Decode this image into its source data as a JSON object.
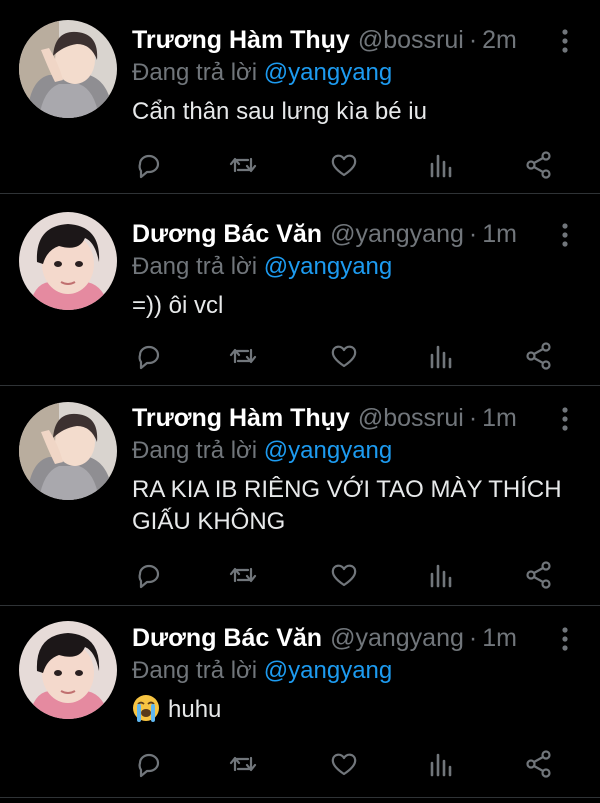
{
  "tweets": [
    {
      "avatar": "avatar-boy-sweater",
      "name": "Trương Hàm Thụy",
      "handle": "@bossrui",
      "dot": "·",
      "time": "2m",
      "replying_prefix": "Đang trả lời ",
      "replying_to": "@yangyang",
      "text": "Cẩn thân sau lưng kìa bé iu"
    },
    {
      "avatar": "avatar-boy-closeup",
      "name": "Dương Bác Văn",
      "handle": "@yangyang",
      "dot": "·",
      "time": "1m",
      "replying_prefix": "Đang trả lời ",
      "replying_to": "@yangyang",
      "text": "=)) ôi vcl"
    },
    {
      "avatar": "avatar-boy-sweater",
      "name": "Trương Hàm Thụy",
      "handle": "@bossrui",
      "dot": "·",
      "time": "1m",
      "replying_prefix": "Đang trả lời ",
      "replying_to": "@yangyang",
      "text": "RA KIA IB RIÊNG VỚI TAO MÀY THÍCH GIẤU KHÔNG"
    },
    {
      "avatar": "avatar-boy-closeup",
      "name": "Dương Bác Văn",
      "handle": "@yangyang",
      "dot": "·",
      "time": "1m",
      "replying_prefix": "Đang trả lời ",
      "replying_to": "@yangyang",
      "emoji": "loudly-crying-face-emoji",
      "text": "huhu"
    }
  ],
  "action_icons": [
    "reply-icon",
    "retweet-icon",
    "like-icon",
    "views-icon",
    "share-icon"
  ],
  "colors": {
    "background": "#000000",
    "name": "#ffffff",
    "muted": "#71767b",
    "link": "#1d9bf0",
    "divider": "#2f3336"
  }
}
